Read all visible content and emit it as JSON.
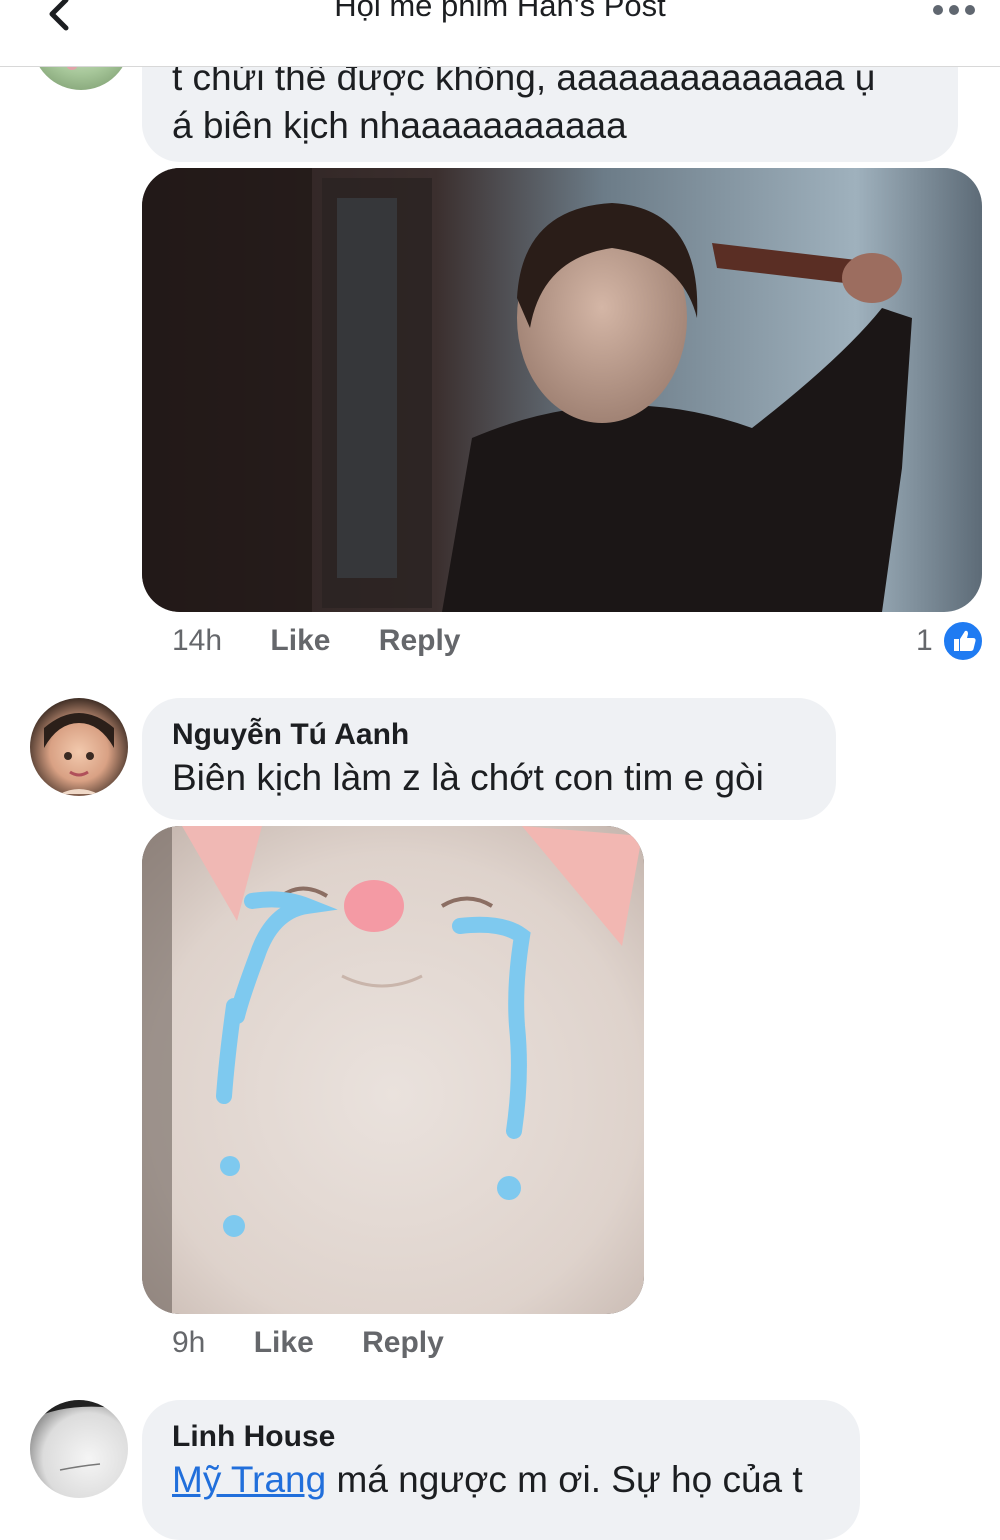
{
  "header": {
    "title": "Hội mê phim Hàn's Post",
    "back_icon": "chevron-left-icon",
    "more_icon": "more-dots-icon"
  },
  "comments": [
    {
      "text_lines": [
        "t chửi thề được không, aaaaaaaaaaaaaa ụ",
        "á biên kịch nhaaaaaaaaaaa"
      ],
      "attachment": "photo-man-with-bat",
      "time": "14h",
      "like_label": "Like",
      "reply_label": "Reply",
      "reaction_count": "1",
      "reaction_icon": "thumbs-up-icon"
    },
    {
      "author": "Nguyễn Tú Aanh",
      "text": "Biên kịch làm z là chớt con tim e gòi",
      "attachment": "photo-crying-cat",
      "time": "9h",
      "like_label": "Like",
      "reply_label": "Reply"
    },
    {
      "author": "Linh House",
      "mention": "Mỹ Trang",
      "text": " má ngược m ơi. Sự họ của t"
    }
  ],
  "colors": {
    "accent": "#1f7bf2",
    "mention": "#216fdb",
    "bubble": "#eff1f4",
    "meta_text": "#65676b"
  }
}
